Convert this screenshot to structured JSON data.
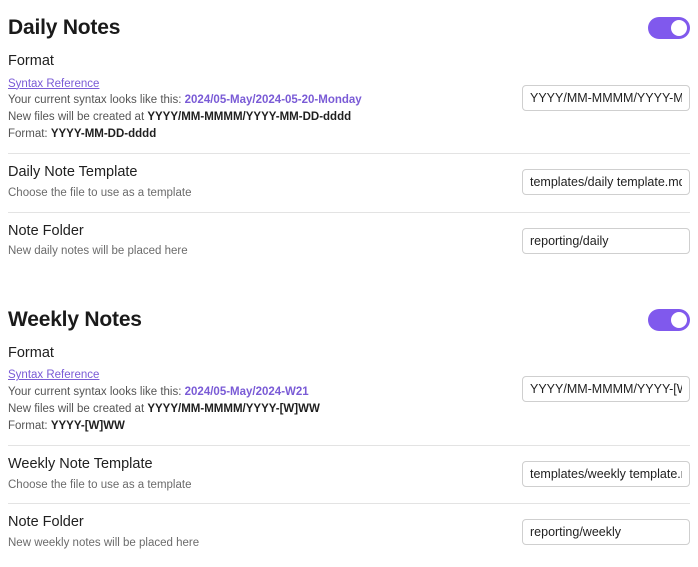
{
  "sections": [
    {
      "key": "daily",
      "title": "Daily Notes",
      "toggle_on": true,
      "format": {
        "label": "Format",
        "syntax_link": "Syntax Reference",
        "current_syntax_prefix": "Your current syntax looks like this: ",
        "current_syntax_value": "2024/05-May/2024-05-20-Monday",
        "new_files_prefix": "New files will be created at ",
        "new_files_value": "YYYY/MM-MMMM/YYYY-MM-DD-dddd",
        "format_prefix": "Format: ",
        "format_value": "YYYY-MM-DD-dddd",
        "input_value": "YYYY/MM-MMMM/YYYY-MM-DD-dddd"
      },
      "template": {
        "label": "Daily Note Template",
        "desc": "Choose the file to use as a template",
        "input_value": "templates/daily template.md"
      },
      "folder": {
        "label": "Note Folder",
        "desc": "New daily notes will be placed here",
        "input_value": "reporting/daily"
      }
    },
    {
      "key": "weekly",
      "title": "Weekly Notes",
      "toggle_on": true,
      "format": {
        "label": "Format",
        "syntax_link": "Syntax Reference",
        "current_syntax_prefix": "Your current syntax looks like this: ",
        "current_syntax_value": "2024/05-May/2024-W21",
        "new_files_prefix": "New files will be created at ",
        "new_files_value": "YYYY/MM-MMMM/YYYY-[W]WW",
        "format_prefix": "Format: ",
        "format_value": "YYYY-[W]WW",
        "input_value": "YYYY/MM-MMMM/YYYY-[W]WW"
      },
      "template": {
        "label": "Weekly Note Template",
        "desc": "Choose the file to use as a template",
        "input_value": "templates/weekly template.md"
      },
      "folder": {
        "label": "Note Folder",
        "desc": "New weekly notes will be placed here",
        "input_value": "reporting/weekly"
      }
    }
  ],
  "colors": {
    "accent": "#8059ed",
    "link": "#7a5bd6",
    "divider": "#e3e3e3",
    "input_border": "#cfcfcf"
  }
}
